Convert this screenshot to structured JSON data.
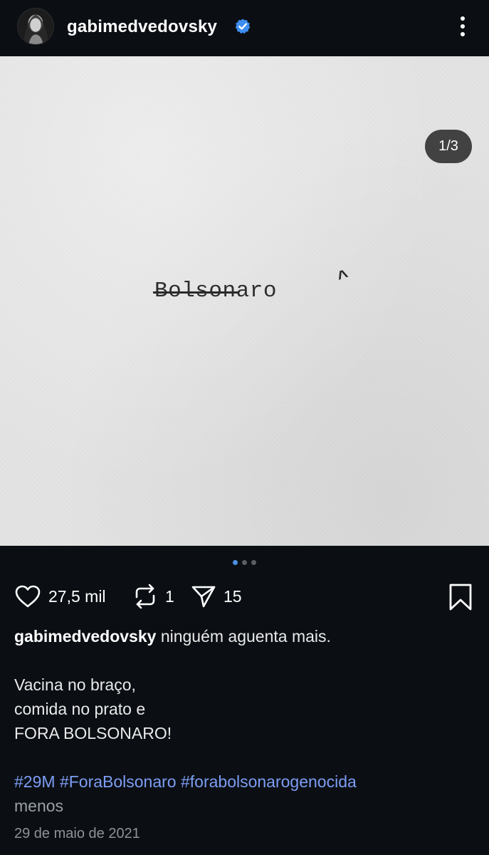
{
  "header": {
    "username": "gabimedvedovsky",
    "verified": true
  },
  "post": {
    "image_text_struck": "Bolson",
    "image_text_rest": "aro",
    "image_caret": "^",
    "page_counter": "1/3",
    "carousel": {
      "total": 3,
      "active": 1
    }
  },
  "actions": {
    "likes": "27,5 mil",
    "reposts": "1",
    "shares": "15"
  },
  "caption": {
    "username": "gabimedvedovsky",
    "first_line": "ninguém aguenta mais.",
    "lines": [
      "Vacina no braço,",
      "comida no prato e",
      "FORA BOLSONARO!"
    ],
    "hashtags": [
      "#29M",
      "#ForaBolsonaro",
      "#forabolsonarogenocida"
    ],
    "less_label": "menos"
  },
  "date": "29 de maio de 2021",
  "colors": {
    "background": "#0b0f14",
    "hashtag": "#7d9df3",
    "dot_active": "#4d8fe3",
    "verified_badge": "#3d8ef0"
  }
}
